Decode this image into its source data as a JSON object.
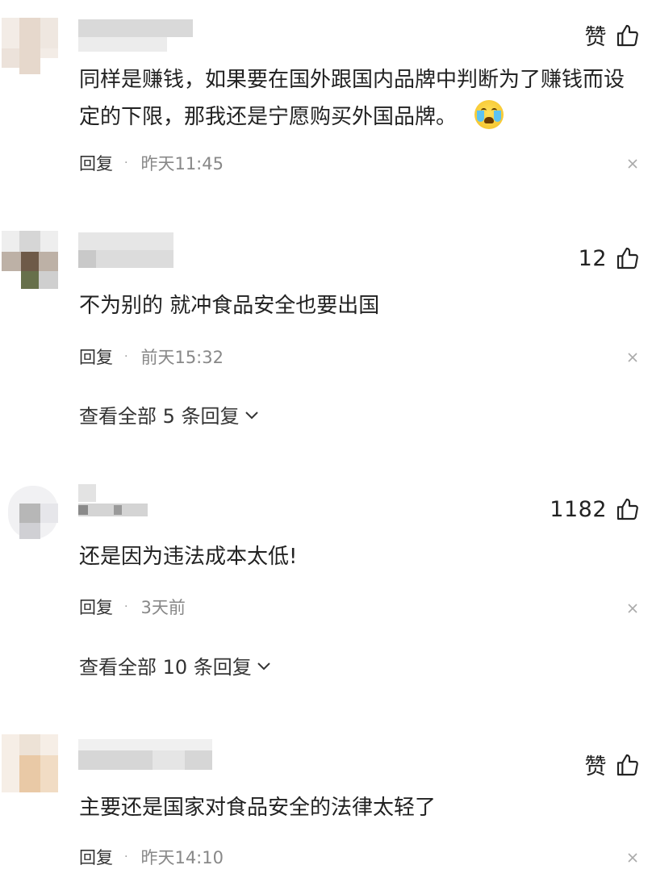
{
  "comments": [
    {
      "like_text": "赞",
      "body": "同样是赚钱，如果要在国外跟国内品牌中判断为了赚钱而设定的下限，那我还是宁愿购买外国品牌。",
      "reply_label": "回复",
      "dot": "·",
      "time": "昨天11:45",
      "emoji_icon": "crying-laughing-emoji"
    },
    {
      "like_text": "12",
      "body": "不为别的 就冲食品安全也要出国",
      "reply_label": "回复",
      "dot": "·",
      "time": "前天15:32",
      "view_all": "查看全部 5 条回复"
    },
    {
      "like_text": "1182",
      "body": "还是因为违法成本太低!",
      "reply_label": "回复",
      "dot": "·",
      "time": "3天前",
      "view_all": "查看全部 10 条回复"
    },
    {
      "like_text": "赞",
      "body": "主要还是国家对食品安全的法律太轻了",
      "reply_label": "回复",
      "dot": "·",
      "time": "昨天14:10"
    }
  ],
  "colors": {
    "text": "#222222",
    "meta": "#888888",
    "close": "#aaaaaa"
  }
}
